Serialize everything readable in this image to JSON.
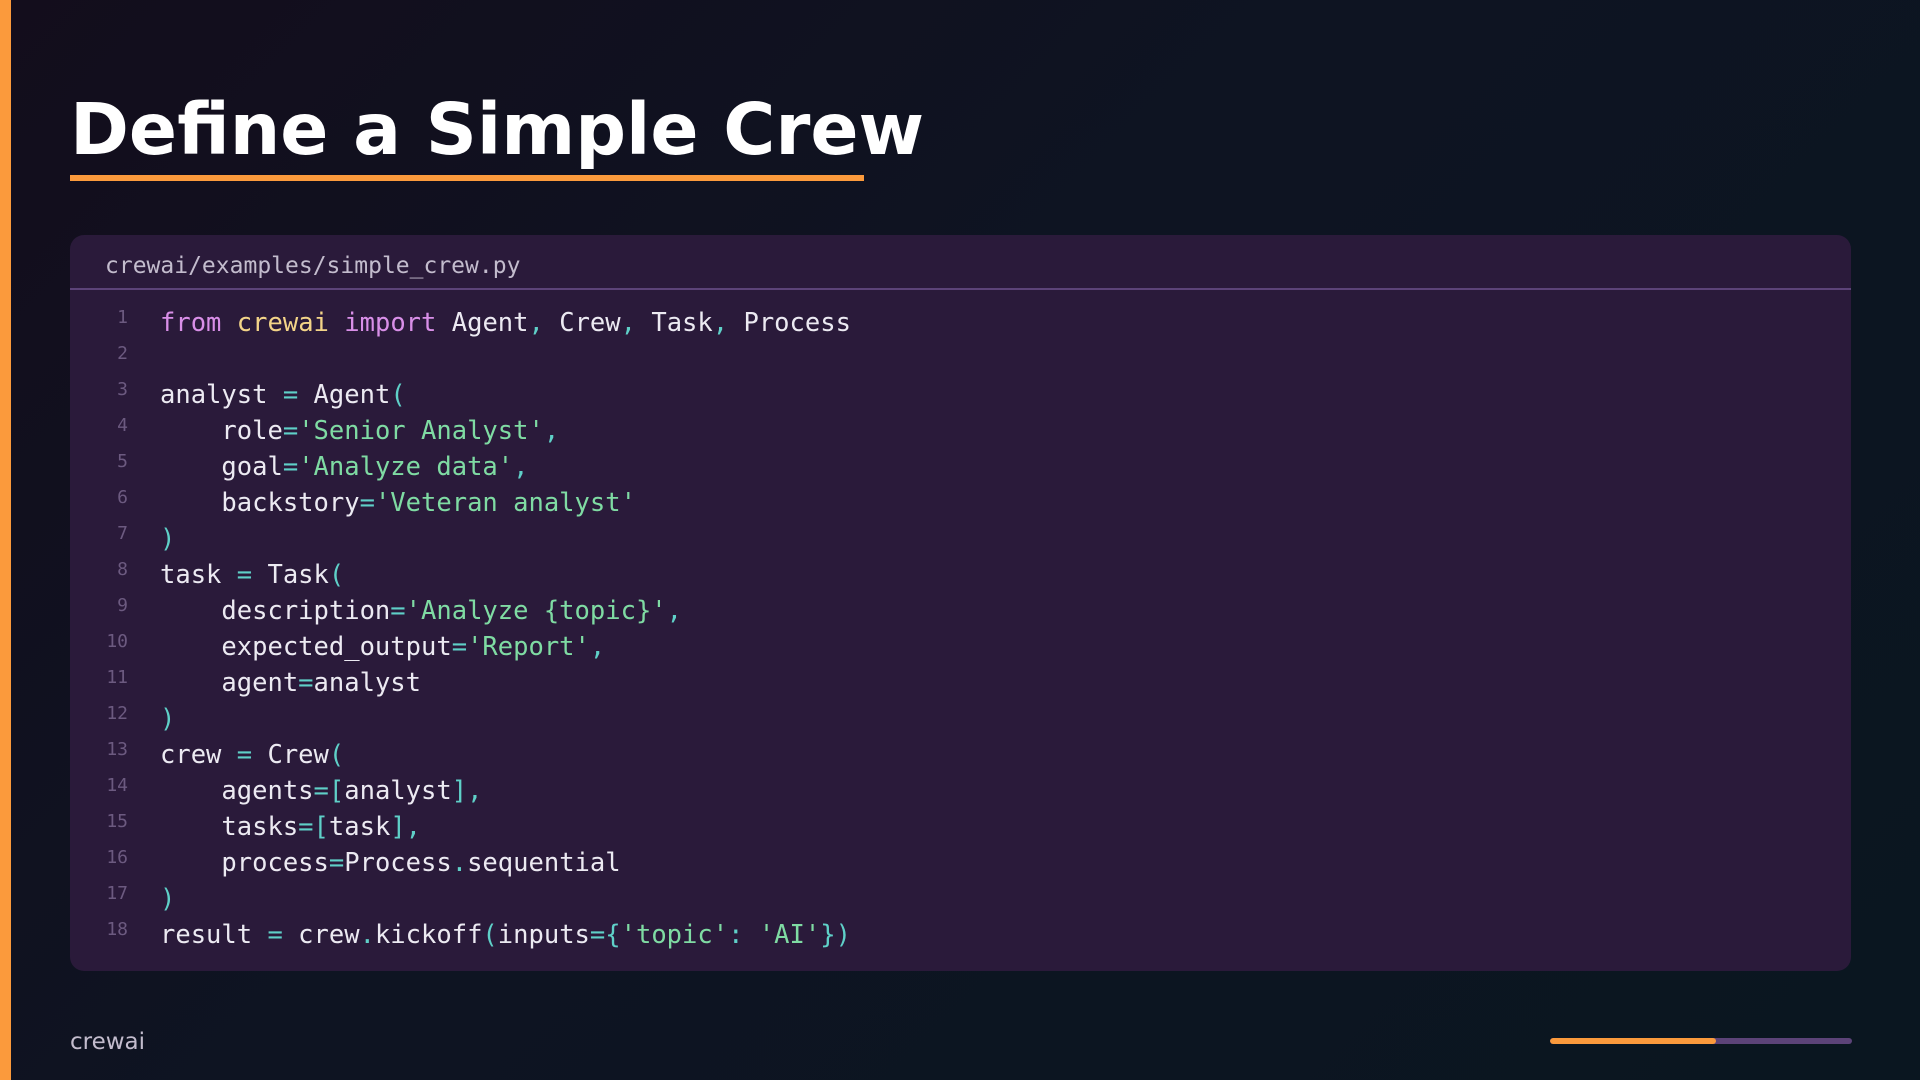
{
  "slide": {
    "title": "Define a Simple Crew",
    "footer_brand": "crewai",
    "progress": 0.55
  },
  "code_block": {
    "file_path": "crewai/examples/simple_crew.py",
    "language": "python",
    "lines": [
      {
        "n": "1",
        "tokens": [
          {
            "t": "from",
            "c": "kw"
          },
          {
            "t": " "
          },
          {
            "t": "crewai",
            "c": "mod"
          },
          {
            "t": " "
          },
          {
            "t": "import",
            "c": "kw"
          },
          {
            "t": " Agent"
          },
          {
            "t": ",",
            "c": "op"
          },
          {
            "t": " Crew"
          },
          {
            "t": ",",
            "c": "op"
          },
          {
            "t": " Task"
          },
          {
            "t": ",",
            "c": "op"
          },
          {
            "t": " Process"
          }
        ]
      },
      {
        "n": "2",
        "tokens": []
      },
      {
        "n": "3",
        "tokens": [
          {
            "t": "analyst "
          },
          {
            "t": "=",
            "c": "op"
          },
          {
            "t": " Agent"
          },
          {
            "t": "(",
            "c": "op"
          }
        ]
      },
      {
        "n": "4",
        "tokens": [
          {
            "t": "    role"
          },
          {
            "t": "=",
            "c": "op"
          },
          {
            "t": "'Senior Analyst'",
            "c": "str"
          },
          {
            "t": ",",
            "c": "op"
          }
        ]
      },
      {
        "n": "5",
        "tokens": [
          {
            "t": "    goal"
          },
          {
            "t": "=",
            "c": "op"
          },
          {
            "t": "'Analyze data'",
            "c": "str"
          },
          {
            "t": ",",
            "c": "op"
          }
        ]
      },
      {
        "n": "6",
        "tokens": [
          {
            "t": "    backstory"
          },
          {
            "t": "=",
            "c": "op"
          },
          {
            "t": "'Veteran analyst'",
            "c": "str"
          }
        ]
      },
      {
        "n": "7",
        "tokens": [
          {
            "t": ")",
            "c": "op"
          }
        ]
      },
      {
        "n": "8",
        "tokens": [
          {
            "t": "task "
          },
          {
            "t": "=",
            "c": "op"
          },
          {
            "t": " Task"
          },
          {
            "t": "(",
            "c": "op"
          }
        ]
      },
      {
        "n": "9",
        "tokens": [
          {
            "t": "    description"
          },
          {
            "t": "=",
            "c": "op"
          },
          {
            "t": "'Analyze {topic}'",
            "c": "str"
          },
          {
            "t": ",",
            "c": "op"
          }
        ]
      },
      {
        "n": "10",
        "tokens": [
          {
            "t": "    expected_output"
          },
          {
            "t": "=",
            "c": "op"
          },
          {
            "t": "'Report'",
            "c": "str"
          },
          {
            "t": ",",
            "c": "op"
          }
        ]
      },
      {
        "n": "11",
        "tokens": [
          {
            "t": "    agent"
          },
          {
            "t": "=",
            "c": "op"
          },
          {
            "t": "analyst"
          }
        ]
      },
      {
        "n": "12",
        "tokens": [
          {
            "t": ")",
            "c": "op"
          }
        ]
      },
      {
        "n": "13",
        "tokens": [
          {
            "t": "crew "
          },
          {
            "t": "=",
            "c": "op"
          },
          {
            "t": " Crew"
          },
          {
            "t": "(",
            "c": "op"
          }
        ]
      },
      {
        "n": "14",
        "tokens": [
          {
            "t": "    agents"
          },
          {
            "t": "=[",
            "c": "op"
          },
          {
            "t": "analyst"
          },
          {
            "t": "],",
            "c": "op"
          }
        ]
      },
      {
        "n": "15",
        "tokens": [
          {
            "t": "    tasks"
          },
          {
            "t": "=[",
            "c": "op"
          },
          {
            "t": "task"
          },
          {
            "t": "],",
            "c": "op"
          }
        ]
      },
      {
        "n": "16",
        "tokens": [
          {
            "t": "    process"
          },
          {
            "t": "=",
            "c": "op"
          },
          {
            "t": "Process"
          },
          {
            "t": ".",
            "c": "op"
          },
          {
            "t": "sequential"
          }
        ]
      },
      {
        "n": "17",
        "tokens": [
          {
            "t": ")",
            "c": "op"
          }
        ]
      },
      {
        "n": "18",
        "tokens": [
          {
            "t": "result "
          },
          {
            "t": "=",
            "c": "op"
          },
          {
            "t": " crew"
          },
          {
            "t": ".",
            "c": "op"
          },
          {
            "t": "kickoff"
          },
          {
            "t": "(",
            "c": "op"
          },
          {
            "t": "inputs"
          },
          {
            "t": "={",
            "c": "op"
          },
          {
            "t": "'topic'",
            "c": "str"
          },
          {
            "t": ": ",
            "c": "op"
          },
          {
            "t": "'AI'",
            "c": "str"
          },
          {
            "t": "})",
            "c": "op"
          }
        ]
      }
    ]
  },
  "colors": {
    "accent": "#fb9a3c",
    "code_background": "#2a1a3a",
    "keyword": "#d98fe8",
    "module": "#f3d488",
    "string": "#7fdba3",
    "operator": "#5fd0c8",
    "text": "#eceaf2"
  }
}
